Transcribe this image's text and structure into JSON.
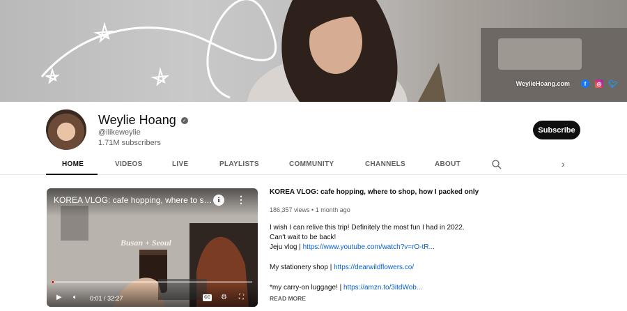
{
  "banner": {
    "site": "WeylieHoang.com",
    "social_icons": [
      "facebook-icon",
      "instagram-icon",
      "twitter-icon"
    ]
  },
  "channel": {
    "name": "Weylie Hoang",
    "handle": "@ilikeweylie",
    "subscribers": "1.71M subscribers",
    "subscribe_label": "Subscribe"
  },
  "tabs": [
    {
      "label": "HOME",
      "active": true
    },
    {
      "label": "VIDEOS"
    },
    {
      "label": "LIVE"
    },
    {
      "label": "PLAYLISTS"
    },
    {
      "label": "COMMUNITY"
    },
    {
      "label": "CHANNELS"
    },
    {
      "label": "ABOUT"
    }
  ],
  "player": {
    "title": "KOREA VLOG: cafe hopping, where to shop, how I packed only a carry-on",
    "overlay_text": "Busan + Seoul",
    "time": "0:01 / 32:27",
    "progress": 0.0005,
    "cc_label": "CC"
  },
  "video": {
    "title": "KOREA VLOG: cafe hopping, where to shop, how I packed only ...",
    "meta": "186,357 views • 1 month ago",
    "desc_line1": "I wish I can relive this trip! Definitely the most fun I had in 2022.",
    "desc_line2": "Can't wait to be back!",
    "jeju_label": "Jeju vlog | ",
    "jeju_link": "https://www.youtube.com/watch?v=rO-tR...",
    "shop_label": "My stationery shop | ",
    "shop_link": "https://dearwildflowers.co/",
    "luggage_label": "*my carry-on luggage! | ",
    "luggage_link": "https://amzn.to/3itdWob...",
    "read_more": "READ MORE"
  },
  "colors": {
    "accent": "#065fd4",
    "subscribe_bg": "#0f0f0f",
    "progress": "#ff0000"
  }
}
